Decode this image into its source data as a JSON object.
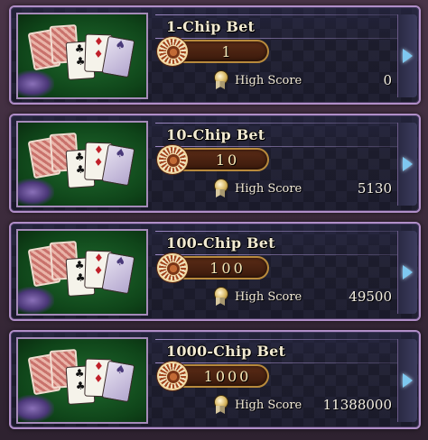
{
  "bets": [
    {
      "title": "1-Chip Bet",
      "chip_value": "1",
      "score_label": "High Score",
      "score_value": "0"
    },
    {
      "title": "10-Chip Bet",
      "chip_value": "10",
      "score_label": "High Score",
      "score_value": "5130"
    },
    {
      "title": "100-Chip Bet",
      "chip_value": "100",
      "score_label": "High Score",
      "score_value": "49500"
    },
    {
      "title": "1000-Chip Bet",
      "chip_value": "1000",
      "score_label": "High Score",
      "score_value": "11388000"
    }
  ],
  "icons": {
    "chip": "poker-chip-icon",
    "score": "medal-icon",
    "arrow": "arrow-right-icon",
    "thumbnail": "playing-cards-image"
  },
  "colors": {
    "panel_border": "#b08ec8",
    "title_text": "#f2ead2",
    "chip_value_text": "#f7e9b8",
    "arrow": "#7ec8f0"
  }
}
